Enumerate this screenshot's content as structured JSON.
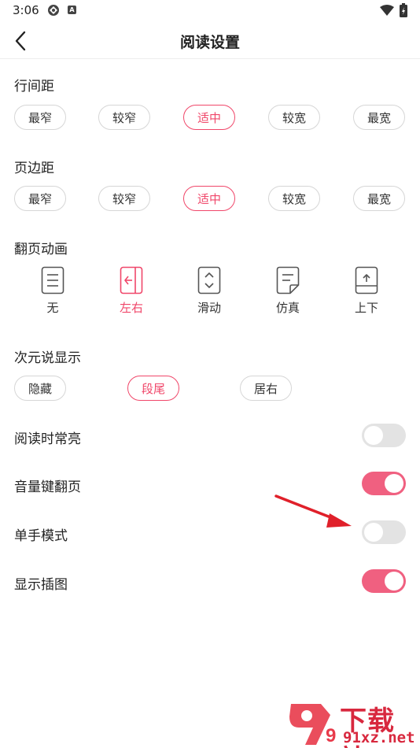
{
  "status_bar": {
    "time": "3:06",
    "app_icon_letter": "A"
  },
  "header": {
    "title": "阅读设置"
  },
  "line_spacing": {
    "title": "行间距",
    "options": [
      "最窄",
      "较窄",
      "适中",
      "较宽",
      "最宽"
    ],
    "selected": "适中"
  },
  "page_margin": {
    "title": "页边距",
    "options": [
      "最窄",
      "较窄",
      "适中",
      "较宽",
      "最宽"
    ],
    "selected": "适中"
  },
  "page_animation": {
    "title": "翻页动画",
    "options": [
      {
        "label": "无",
        "icon": "page-lines-icon"
      },
      {
        "label": "左右",
        "icon": "page-left-right-icon"
      },
      {
        "label": "滑动",
        "icon": "page-slide-icon"
      },
      {
        "label": "仿真",
        "icon": "page-curl-icon"
      },
      {
        "label": "上下",
        "icon": "page-up-down-icon"
      }
    ],
    "selected": "左右"
  },
  "ciyuan_display": {
    "title": "次元说显示",
    "options": [
      "隐藏",
      "段尾",
      "居右"
    ],
    "selected": "段尾"
  },
  "toggles": [
    {
      "label": "阅读时常亮",
      "on": false
    },
    {
      "label": "音量键翻页",
      "on": true
    },
    {
      "label": "单手模式",
      "on": false
    },
    {
      "label": "显示插图",
      "on": true
    }
  ],
  "colors": {
    "accent": "#f0476a",
    "toggle_on": "#f06080",
    "toggle_off": "#e3e3e3",
    "annotation_arrow": "#e0202a"
  },
  "watermark": {
    "logo_text": "9",
    "line1": "下载站",
    "line2": "91xz.net"
  }
}
